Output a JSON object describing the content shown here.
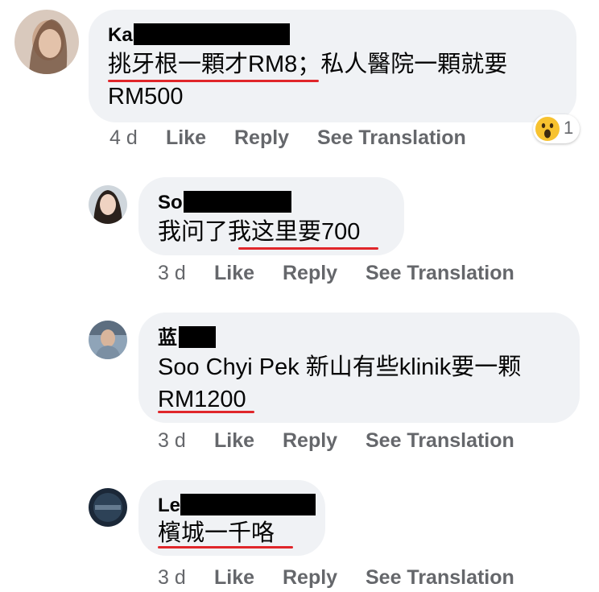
{
  "comments": [
    {
      "name": "Ka",
      "text_line1": "挑牙根一顆才RM8；私人醫院一顆就要",
      "text_line2": "RM500",
      "time": "4 d",
      "like": "Like",
      "reply": "Reply",
      "translate": "See Translation",
      "reaction": {
        "icon": "wow-reaction-icon",
        "count": "1"
      }
    },
    {
      "name": "So",
      "text_line1": "我问了我这里要700",
      "time": "3 d",
      "like": "Like",
      "reply": "Reply",
      "translate": "See Translation"
    },
    {
      "name": "蓝",
      "text_line1": "Soo Chyi Pek 新山有些klinik要一颗",
      "text_line2": "RM1200",
      "time": "3 d",
      "like": "Like",
      "reply": "Reply",
      "translate": "See Translation"
    },
    {
      "name": "Le",
      "text_line1": "檳城一千咯",
      "time": "3 d",
      "like": "Like",
      "reply": "Reply",
      "translate": "See Translation"
    }
  ],
  "colors": {
    "bubble": "#f0f2f5",
    "underline": "#e0262a",
    "muted": "#65676b",
    "text": "#050505"
  }
}
